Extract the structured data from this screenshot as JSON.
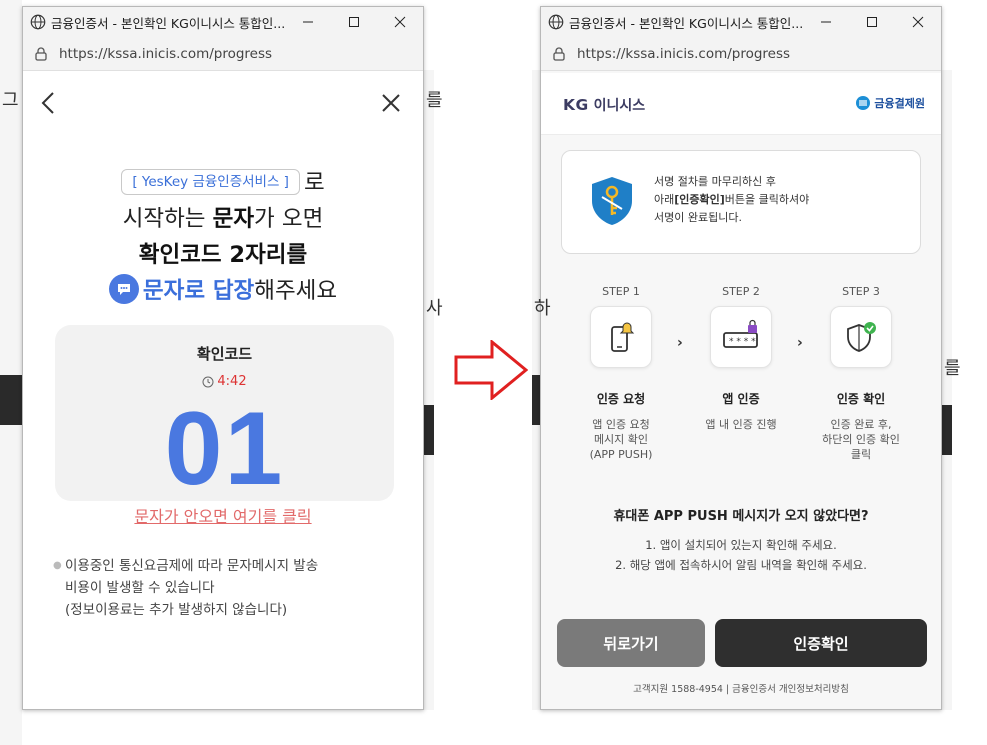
{
  "left_window": {
    "title": "금융인증서 - 본인확인 KG이니시스 통합인...",
    "url": "https://kssa.inicis.com/progress",
    "service_chip": "[ YesKey 금융인증서비스 ]",
    "line1_suffix": "로",
    "line2_pre": "시작하는 ",
    "line2_bold": "문자",
    "line2_post": "가 오면",
    "line3": "확인코드 2자리를",
    "line4_blue": "문자로 답장",
    "line4_post": "해주세요",
    "code_title": "확인코드",
    "timer": "4:42",
    "code": "01",
    "resend_link": "문자가 안오면 여기를 클릭",
    "notes": [
      "이용중인 통신요금제에 따라 문자메시지 발송",
      "비용이 발생할 수 있습니다",
      "(정보이용료는 추가 발생하지 않습니다)"
    ]
  },
  "right_window": {
    "title": "금융인증서 - 본인확인 KG이니시스 통합인...",
    "url": "https://kssa.inicis.com/progress",
    "brand_kg": "KG",
    "brand_name": "이니시스",
    "fin_logo": "금융결제원",
    "info": {
      "line1": "서명 절차를 마무리하신 후",
      "line2_pre": "아래",
      "line2_bold": "[인증확인]",
      "line2_post": "버튼을 클릭하셔야",
      "line3": "서명이 완료됩니다."
    },
    "steps": [
      {
        "label": "STEP 1",
        "title": "인증 요청",
        "desc": [
          "앱 인증 요청",
          "메시지 확인",
          "(APP PUSH)"
        ],
        "icon": "phone-bell-icon"
      },
      {
        "label": "STEP 2",
        "title": "앱 인증",
        "desc": [
          "앱 내 인증 진행"
        ],
        "icon": "password-lock-icon"
      },
      {
        "label": "STEP 3",
        "title": "인증 확인",
        "desc": [
          "인증 완료 후,",
          "하단의 인증 확인",
          "클릭"
        ],
        "icon": "shield-check-icon"
      }
    ],
    "push_question": "휴대폰 APP PUSH 메시지가 오지 않았다면?",
    "push_answers": [
      "1. 앱이 설치되어 있는지 확인해 주세요.",
      "2. 해당 앱에 접속하시어 알림 내역을 확인해 주세요."
    ],
    "back_button": "뒤로가기",
    "confirm_button": "인증확인",
    "footer": "고객지원 1588-4954 | 금융인증서 개인정보처리방침"
  },
  "background": {
    "fragments": [
      "그",
      "를",
      "사",
      "하",
      "를"
    ]
  },
  "colors": {
    "accent_blue": "#4a78e0",
    "link_red": "#e26a6a",
    "timer_red": "#d33333",
    "dark_button": "#2f2f2f",
    "grey_button": "#7a7a7a",
    "arrow_red": "#e02020"
  }
}
